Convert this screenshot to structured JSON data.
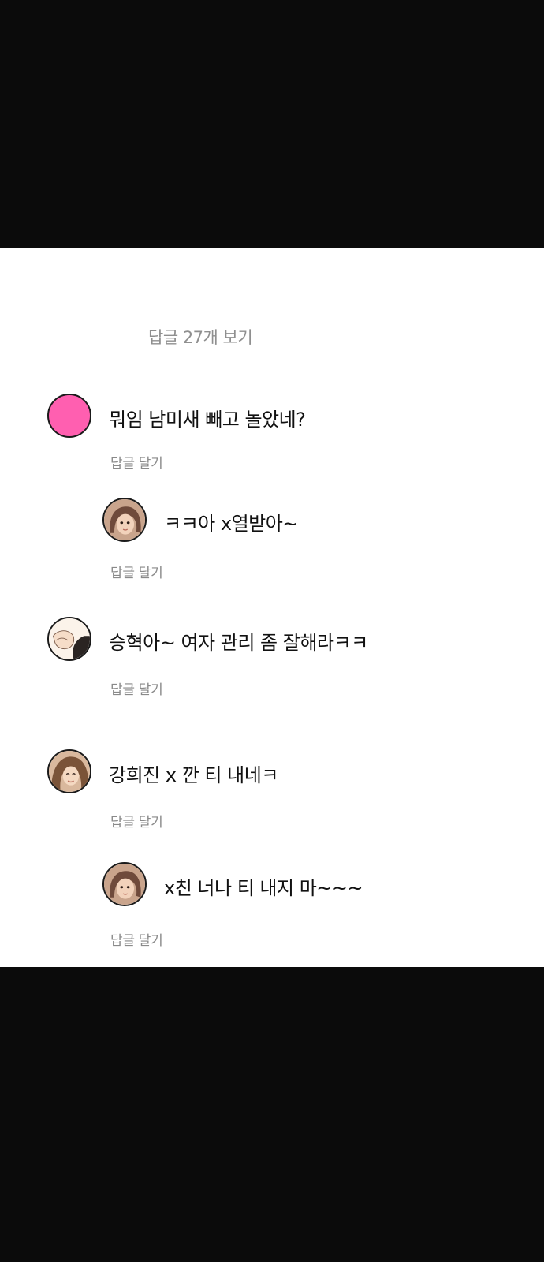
{
  "thread": {
    "view_replies_label": "답글 27개 보기"
  },
  "comments": [
    {
      "text": "뭐임 남미새 빼고 놀았네?",
      "reply_label": "답글 달기",
      "avatar": "pink-avatar-icon",
      "avatar_color": "#ff5fb0"
    },
    {
      "text": "ㅋㅋ아 x열받아~",
      "reply_label": "답글 달기",
      "avatar": "brown-hair-girl-avatar-icon"
    },
    {
      "text": "승혁아~ 여자 관리 좀 잘해라ㅋㅋ",
      "reply_label": "답글 달기",
      "avatar": "sketch-character-avatar-icon"
    },
    {
      "text": "강희진 x 깐 티 내네ㅋ",
      "reply_label": "답글 달기",
      "avatar": "long-hair-character-avatar-icon"
    },
    {
      "text": "x친 너나 티 내지 마~~~",
      "reply_label": "답글 달기",
      "avatar": "brown-hair-girl-avatar-icon"
    }
  ],
  "colors": {
    "background_dark": "#0b0b0b",
    "panel": "#ffffff",
    "muted_text": "#8a8a8a",
    "comment_text": "#111111"
  }
}
